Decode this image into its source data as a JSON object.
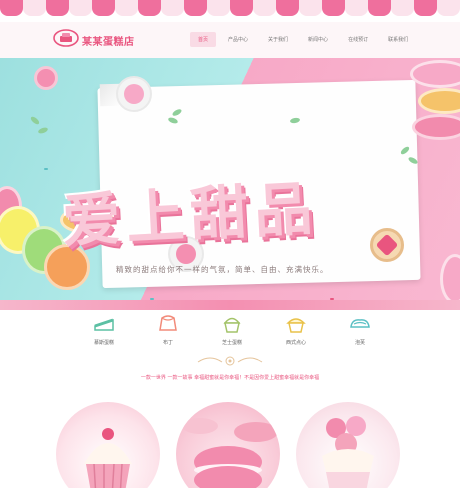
{
  "brand": {
    "name": "某某蛋糕店"
  },
  "nav": [
    {
      "label": "首页",
      "active": true
    },
    {
      "label": "产品中心",
      "active": false
    },
    {
      "label": "关于我们",
      "active": false
    },
    {
      "label": "新闻中心",
      "active": false
    },
    {
      "label": "在线预订",
      "active": false
    },
    {
      "label": "联系我们",
      "active": false
    }
  ],
  "banner": {
    "headline": "爱上甜品",
    "tagline": "精致的甜点给你不一样的气氛，简单、自由、充满快乐。"
  },
  "categories": [
    {
      "label": "慕斯蛋糕",
      "icon": "cake-slice-icon"
    },
    {
      "label": "布丁",
      "icon": "pudding-icon"
    },
    {
      "label": "芝士蛋糕",
      "icon": "cupcake-icon"
    },
    {
      "label": "西式点心",
      "icon": "muffin-icon"
    },
    {
      "label": "泡芙",
      "icon": "cream-puff-icon"
    }
  ],
  "intro": {
    "text": "一款一世界 一款一故事 幸福甜蜜就是你幸福！不是因你爱上甜蜜幸福就是你幸福"
  },
  "colors": {
    "brand_pink": "#e9557f",
    "mint": "#9de0df",
    "banner_pink": "#f7a9c7"
  }
}
